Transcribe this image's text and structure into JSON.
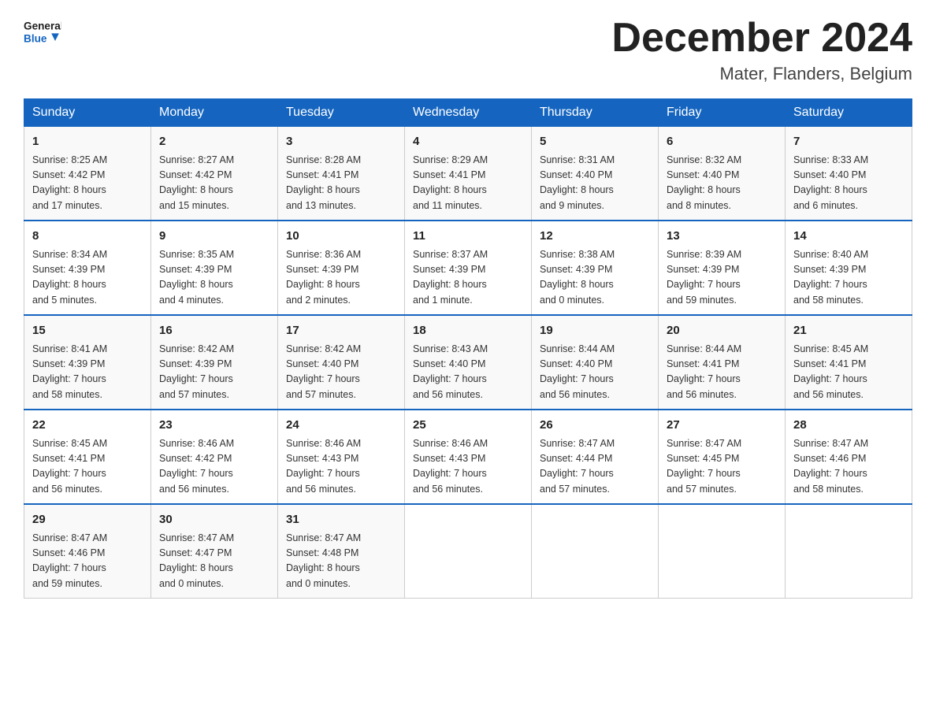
{
  "header": {
    "logo_text_general": "General",
    "logo_text_blue": "Blue",
    "title": "December 2024",
    "location": "Mater, Flanders, Belgium"
  },
  "calendar": {
    "days_of_week": [
      "Sunday",
      "Monday",
      "Tuesday",
      "Wednesday",
      "Thursday",
      "Friday",
      "Saturday"
    ],
    "weeks": [
      [
        {
          "day": "1",
          "info": "Sunrise: 8:25 AM\nSunset: 4:42 PM\nDaylight: 8 hours\nand 17 minutes."
        },
        {
          "day": "2",
          "info": "Sunrise: 8:27 AM\nSunset: 4:42 PM\nDaylight: 8 hours\nand 15 minutes."
        },
        {
          "day": "3",
          "info": "Sunrise: 8:28 AM\nSunset: 4:41 PM\nDaylight: 8 hours\nand 13 minutes."
        },
        {
          "day": "4",
          "info": "Sunrise: 8:29 AM\nSunset: 4:41 PM\nDaylight: 8 hours\nand 11 minutes."
        },
        {
          "day": "5",
          "info": "Sunrise: 8:31 AM\nSunset: 4:40 PM\nDaylight: 8 hours\nand 9 minutes."
        },
        {
          "day": "6",
          "info": "Sunrise: 8:32 AM\nSunset: 4:40 PM\nDaylight: 8 hours\nand 8 minutes."
        },
        {
          "day": "7",
          "info": "Sunrise: 8:33 AM\nSunset: 4:40 PM\nDaylight: 8 hours\nand 6 minutes."
        }
      ],
      [
        {
          "day": "8",
          "info": "Sunrise: 8:34 AM\nSunset: 4:39 PM\nDaylight: 8 hours\nand 5 minutes."
        },
        {
          "day": "9",
          "info": "Sunrise: 8:35 AM\nSunset: 4:39 PM\nDaylight: 8 hours\nand 4 minutes."
        },
        {
          "day": "10",
          "info": "Sunrise: 8:36 AM\nSunset: 4:39 PM\nDaylight: 8 hours\nand 2 minutes."
        },
        {
          "day": "11",
          "info": "Sunrise: 8:37 AM\nSunset: 4:39 PM\nDaylight: 8 hours\nand 1 minute."
        },
        {
          "day": "12",
          "info": "Sunrise: 8:38 AM\nSunset: 4:39 PM\nDaylight: 8 hours\nand 0 minutes."
        },
        {
          "day": "13",
          "info": "Sunrise: 8:39 AM\nSunset: 4:39 PM\nDaylight: 7 hours\nand 59 minutes."
        },
        {
          "day": "14",
          "info": "Sunrise: 8:40 AM\nSunset: 4:39 PM\nDaylight: 7 hours\nand 58 minutes."
        }
      ],
      [
        {
          "day": "15",
          "info": "Sunrise: 8:41 AM\nSunset: 4:39 PM\nDaylight: 7 hours\nand 58 minutes."
        },
        {
          "day": "16",
          "info": "Sunrise: 8:42 AM\nSunset: 4:39 PM\nDaylight: 7 hours\nand 57 minutes."
        },
        {
          "day": "17",
          "info": "Sunrise: 8:42 AM\nSunset: 4:40 PM\nDaylight: 7 hours\nand 57 minutes."
        },
        {
          "day": "18",
          "info": "Sunrise: 8:43 AM\nSunset: 4:40 PM\nDaylight: 7 hours\nand 56 minutes."
        },
        {
          "day": "19",
          "info": "Sunrise: 8:44 AM\nSunset: 4:40 PM\nDaylight: 7 hours\nand 56 minutes."
        },
        {
          "day": "20",
          "info": "Sunrise: 8:44 AM\nSunset: 4:41 PM\nDaylight: 7 hours\nand 56 minutes."
        },
        {
          "day": "21",
          "info": "Sunrise: 8:45 AM\nSunset: 4:41 PM\nDaylight: 7 hours\nand 56 minutes."
        }
      ],
      [
        {
          "day": "22",
          "info": "Sunrise: 8:45 AM\nSunset: 4:41 PM\nDaylight: 7 hours\nand 56 minutes."
        },
        {
          "day": "23",
          "info": "Sunrise: 8:46 AM\nSunset: 4:42 PM\nDaylight: 7 hours\nand 56 minutes."
        },
        {
          "day": "24",
          "info": "Sunrise: 8:46 AM\nSunset: 4:43 PM\nDaylight: 7 hours\nand 56 minutes."
        },
        {
          "day": "25",
          "info": "Sunrise: 8:46 AM\nSunset: 4:43 PM\nDaylight: 7 hours\nand 56 minutes."
        },
        {
          "day": "26",
          "info": "Sunrise: 8:47 AM\nSunset: 4:44 PM\nDaylight: 7 hours\nand 57 minutes."
        },
        {
          "day": "27",
          "info": "Sunrise: 8:47 AM\nSunset: 4:45 PM\nDaylight: 7 hours\nand 57 minutes."
        },
        {
          "day": "28",
          "info": "Sunrise: 8:47 AM\nSunset: 4:46 PM\nDaylight: 7 hours\nand 58 minutes."
        }
      ],
      [
        {
          "day": "29",
          "info": "Sunrise: 8:47 AM\nSunset: 4:46 PM\nDaylight: 7 hours\nand 59 minutes."
        },
        {
          "day": "30",
          "info": "Sunrise: 8:47 AM\nSunset: 4:47 PM\nDaylight: 8 hours\nand 0 minutes."
        },
        {
          "day": "31",
          "info": "Sunrise: 8:47 AM\nSunset: 4:48 PM\nDaylight: 8 hours\nand 0 minutes."
        },
        {
          "day": "",
          "info": ""
        },
        {
          "day": "",
          "info": ""
        },
        {
          "day": "",
          "info": ""
        },
        {
          "day": "",
          "info": ""
        }
      ]
    ]
  }
}
